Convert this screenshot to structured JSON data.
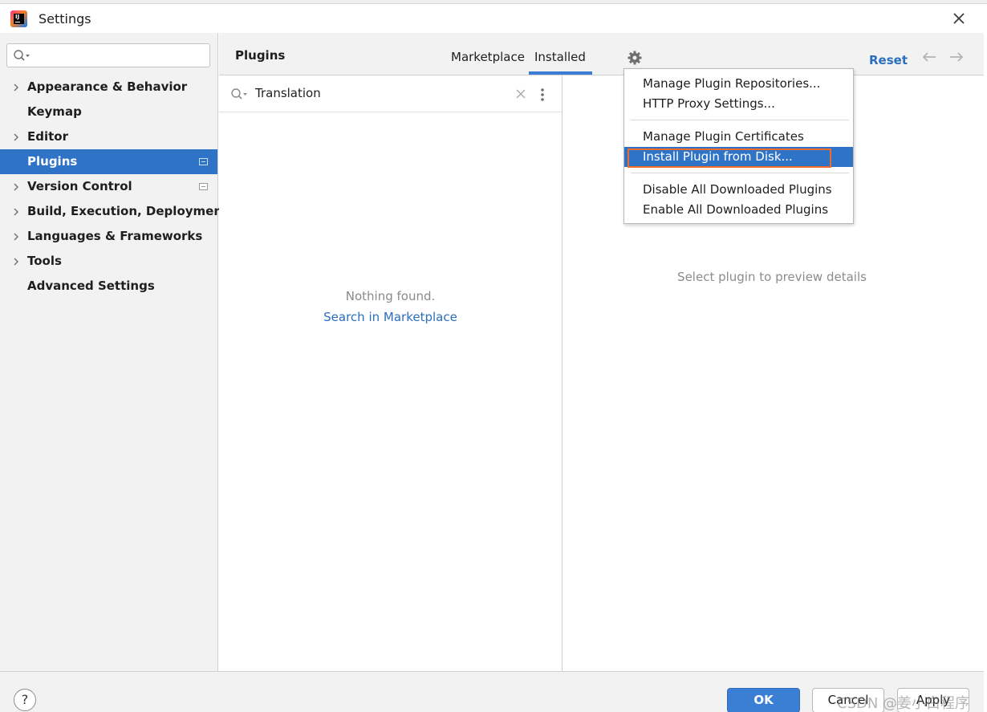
{
  "window": {
    "title": "Settings"
  },
  "sidebar": {
    "search_placeholder": "",
    "items": [
      {
        "label": "Appearance & Behavior",
        "expandable": true,
        "selected": false,
        "project_icon": false
      },
      {
        "label": "Keymap",
        "expandable": false,
        "selected": false,
        "project_icon": false
      },
      {
        "label": "Editor",
        "expandable": true,
        "selected": false,
        "project_icon": false
      },
      {
        "label": "Plugins",
        "expandable": false,
        "selected": true,
        "project_icon": true
      },
      {
        "label": "Version Control",
        "expandable": true,
        "selected": false,
        "project_icon": true
      },
      {
        "label": "Build, Execution, Deployment",
        "expandable": true,
        "selected": false,
        "project_icon": false
      },
      {
        "label": "Languages & Frameworks",
        "expandable": true,
        "selected": false,
        "project_icon": false
      },
      {
        "label": "Tools",
        "expandable": true,
        "selected": false,
        "project_icon": false
      },
      {
        "label": "Advanced Settings",
        "expandable": false,
        "selected": false,
        "project_icon": false
      }
    ]
  },
  "header": {
    "title": "Plugins",
    "tabs": [
      {
        "label": "Marketplace",
        "active": false
      },
      {
        "label": "Installed",
        "active": true
      }
    ],
    "reset_label": "Reset"
  },
  "plugin_list": {
    "search_query": "Translation",
    "empty_message": "Nothing found.",
    "search_marketplace_link": "Search in Marketplace"
  },
  "detail": {
    "hint": "Select plugin to preview details"
  },
  "gear_menu": {
    "groups": [
      [
        {
          "label": "Manage Plugin Repositories..."
        },
        {
          "label": "HTTP Proxy Settings..."
        }
      ],
      [
        {
          "label": "Manage Plugin Certificates"
        },
        {
          "label": "Install Plugin from Disk...",
          "selected": true
        }
      ],
      [
        {
          "label": "Disable All Downloaded Plugins"
        },
        {
          "label": "Enable All Downloaded Plugins"
        }
      ]
    ]
  },
  "buttons": {
    "help": "?",
    "ok": "OK",
    "cancel": "Cancel",
    "apply": "Apply"
  },
  "watermark": "CSDN @姜小白程序",
  "colors": {
    "selection": "#2f73c7",
    "link": "#2a6ebd",
    "annotation_box": "#f06a28",
    "ok_button": "#3b7fd4"
  }
}
